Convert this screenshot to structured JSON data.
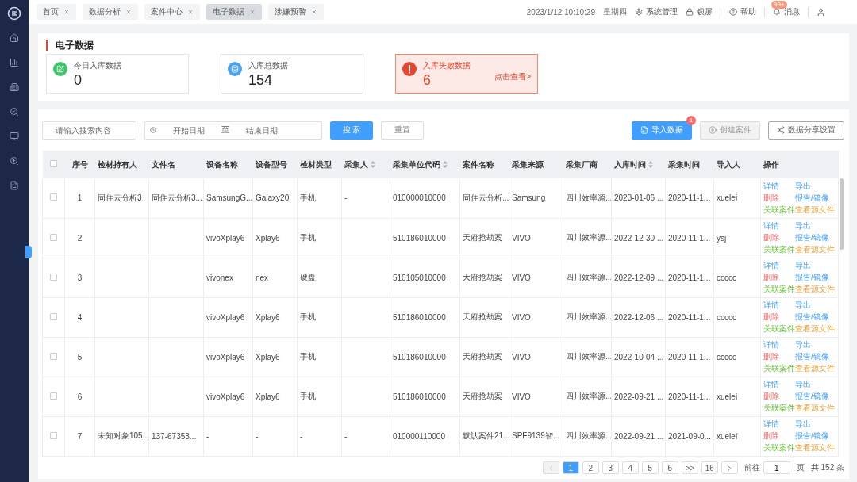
{
  "tabs": [
    {
      "label": "首页",
      "selected": false
    },
    {
      "label": "数据分析",
      "selected": false
    },
    {
      "label": "案件中心",
      "selected": false
    },
    {
      "label": "电子数据",
      "selected": true
    },
    {
      "label": "涉嫌预警",
      "selected": false
    }
  ],
  "header": {
    "datetime": "2023/1/12 10:10:29",
    "weekday": "星期四",
    "items": [
      {
        "kind": "settings",
        "label": "系统管理"
      },
      {
        "kind": "lock",
        "label": "锁屏"
      },
      {
        "kind": "help",
        "label": "帮助"
      },
      {
        "kind": "bell",
        "label": "消息",
        "badge": "99+"
      }
    ]
  },
  "page_title": "电子数据",
  "stats": [
    {
      "kind": "today",
      "label": "今日入库数据",
      "value": "0",
      "alert": false
    },
    {
      "kind": "total",
      "label": "入库总数据",
      "value": "154",
      "alert": false
    },
    {
      "kind": "failed",
      "label": "入库失败数据",
      "value": "6",
      "alert": true,
      "link": "点击查看>"
    }
  ],
  "filters": {
    "search_placeholder": "请输入搜索内容",
    "start_placeholder": "开始日期",
    "separator": "至",
    "end_placeholder": "结束日期",
    "search_button": "搜 索",
    "reset_button": "重置"
  },
  "actions": [
    {
      "kind": "import",
      "label": "导入数据",
      "badge": "1",
      "disabled": false
    },
    {
      "kind": "create",
      "label": "创建案件",
      "disabled": true
    },
    {
      "kind": "share",
      "label": "数据分享设置",
      "disabled": false
    }
  ],
  "table": {
    "select_all_checked": false,
    "columns": [
      {
        "label": "序号",
        "sortable": false
      },
      {
        "label": "检材持有人",
        "sortable": false
      },
      {
        "label": "文件名",
        "sortable": false
      },
      {
        "label": "设备名称",
        "sortable": false
      },
      {
        "label": "设备型号",
        "sortable": false
      },
      {
        "label": "检材类型",
        "sortable": false
      },
      {
        "label": "采集人",
        "sortable": true
      },
      {
        "label": "采集单位代码",
        "sortable": true
      },
      {
        "label": "案件名称",
        "sortable": false
      },
      {
        "label": "采集来源",
        "sortable": false
      },
      {
        "label": "采集厂商",
        "sortable": false
      },
      {
        "label": "入库时间",
        "sortable": true
      },
      {
        "label": "采集时间",
        "sortable": false
      },
      {
        "label": "导入人",
        "sortable": false
      },
      {
        "label": "操作",
        "sortable": false
      }
    ],
    "rows": [
      {
        "checked": false,
        "cells": [
          "1",
          "同住云分析3",
          "同住云分析3...",
          "SamsungG...",
          "Galaxy20",
          "手机",
          "-",
          "010000010000",
          "同住云分析...",
          "Samsung",
          "四川效率源...",
          "2023-01-06 ...",
          "2020-11-1...",
          "xuelei"
        ],
        "ops": [
          {
            "label": "详情",
            "kind": "view"
          },
          {
            "label": "导出",
            "kind": "export"
          },
          {
            "label": "删除",
            "kind": "delete"
          },
          {
            "label": "报告/镜像",
            "kind": "report"
          },
          {
            "label": "关联案件",
            "kind": "link"
          },
          {
            "label": "查看源文件",
            "kind": "source"
          }
        ]
      },
      {
        "checked": false,
        "cells": [
          "2",
          "",
          "",
          "vivoXplay6",
          "Xplay6",
          "手机",
          "",
          "510186010000",
          "天府抢劫案",
          "VIVO",
          "四川效率源...",
          "2022-12-30 ...",
          "2020-11-1...",
          "ysj"
        ],
        "ops": [
          {
            "label": "详情",
            "kind": "view"
          },
          {
            "label": "导出",
            "kind": "export"
          },
          {
            "label": "删除",
            "kind": "delete"
          },
          {
            "label": "报告/镜像",
            "kind": "report"
          },
          {
            "label": "关联案件",
            "kind": "link"
          },
          {
            "label": "查看源文件",
            "kind": "source"
          }
        ]
      },
      {
        "checked": false,
        "cells": [
          "3",
          "",
          "",
          "vivonex",
          "nex",
          "硬盘",
          "",
          "510105010000",
          "天府抢劫案",
          "VIVO",
          "四川效率源...",
          "2022-12-09 ...",
          "2020-11-1...",
          "ccccc"
        ],
        "ops": [
          {
            "label": "详情",
            "kind": "view"
          },
          {
            "label": "导出",
            "kind": "export"
          },
          {
            "label": "删除",
            "kind": "delete"
          },
          {
            "label": "报告/镜像",
            "kind": "report"
          },
          {
            "label": "关联案件",
            "kind": "link"
          },
          {
            "label": "查看源文件",
            "kind": "source"
          }
        ]
      },
      {
        "checked": false,
        "cells": [
          "4",
          "",
          "",
          "vivoXplay6",
          "Xplay6",
          "手机",
          "",
          "510186010000",
          "天府抢劫案",
          "VIVO",
          "四川效率源...",
          "2022-12-06 ...",
          "2020-11-1...",
          "ccccc"
        ],
        "ops": [
          {
            "label": "详情",
            "kind": "view"
          },
          {
            "label": "导出",
            "kind": "export"
          },
          {
            "label": "删除",
            "kind": "delete"
          },
          {
            "label": "报告/镜像",
            "kind": "report"
          },
          {
            "label": "关联案件",
            "kind": "link"
          },
          {
            "label": "查看源文件",
            "kind": "source"
          }
        ]
      },
      {
        "checked": false,
        "cells": [
          "5",
          "",
          "",
          "vivoXplay6",
          "Xplay6",
          "手机",
          "",
          "510186010000",
          "天府抢劫案",
          "VIVO",
          "四川效率源...",
          "2022-10-04 ...",
          "2020-11-1...",
          "ccccc"
        ],
        "ops": [
          {
            "label": "详情",
            "kind": "view"
          },
          {
            "label": "导出",
            "kind": "export"
          },
          {
            "label": "删除",
            "kind": "delete"
          },
          {
            "label": "报告/镜像",
            "kind": "report"
          },
          {
            "label": "关联案件",
            "kind": "link"
          },
          {
            "label": "查看源文件",
            "kind": "source"
          }
        ]
      },
      {
        "checked": false,
        "cells": [
          "6",
          "",
          "",
          "vivoXplay6",
          "Xplay6",
          "手机",
          "",
          "510186010000",
          "天府抢劫案",
          "VIVO",
          "四川效率源...",
          "2022-09-21 ...",
          "2020-11-1...",
          "xuelei"
        ],
        "ops": [
          {
            "label": "详情",
            "kind": "view"
          },
          {
            "label": "导出",
            "kind": "export"
          },
          {
            "label": "删除",
            "kind": "delete"
          },
          {
            "label": "报告/镜像",
            "kind": "report"
          },
          {
            "label": "关联案件",
            "kind": "link"
          },
          {
            "label": "查看源文件",
            "kind": "source"
          }
        ]
      },
      {
        "checked": false,
        "cells": [
          "7",
          "未知对象105...",
          "137-67353...",
          "-",
          "-",
          "-",
          "-",
          "010000110000",
          "默认案件21...",
          "SPF9139智...",
          "四川效率源...",
          "2022-09-21 ...",
          "2021-09-0...",
          "xuelei"
        ],
        "ops": [
          {
            "label": "详情",
            "kind": "view"
          },
          {
            "label": "导出",
            "kind": "export"
          },
          {
            "label": "删除",
            "kind": "delete"
          },
          {
            "label": "报告/镜像",
            "kind": "report"
          },
          {
            "label": "关联案件",
            "kind": "link"
          },
          {
            "label": "查看源文件",
            "kind": "source"
          }
        ]
      }
    ]
  },
  "pagination": {
    "prev_disabled": true,
    "pages": [
      {
        "label": "1",
        "selected": true
      },
      {
        "label": "2",
        "selected": false
      },
      {
        "label": "3",
        "selected": false
      },
      {
        "label": "4",
        "selected": false
      },
      {
        "label": "5",
        "selected": false
      },
      {
        "label": "6",
        "selected": false
      },
      {
        "label": ">>",
        "selected": false
      },
      {
        "label": "16",
        "selected": false
      }
    ],
    "goto_label": "前往",
    "goto_value": "1",
    "page_unit": "页",
    "total": "共 152 条"
  }
}
